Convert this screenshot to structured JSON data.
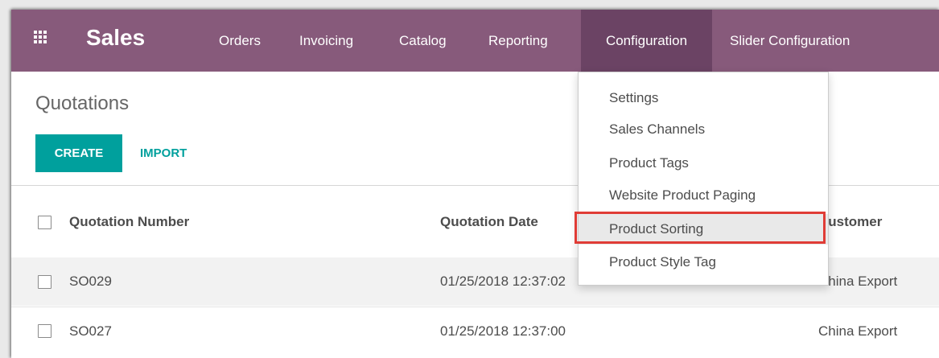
{
  "navbar": {
    "app_title": "Sales",
    "menu": [
      {
        "label": "Orders"
      },
      {
        "label": "Invoicing"
      },
      {
        "label": "Catalog"
      },
      {
        "label": "Reporting"
      },
      {
        "label": "Configuration",
        "active": true
      },
      {
        "label": "Slider Configuration"
      }
    ],
    "apps_icon": "grid-icon",
    "bg_color": "#875a7b",
    "active_bg_color": "#6b4364"
  },
  "page": {
    "title": "Quotations",
    "create_label": "CREATE",
    "import_label": "IMPORT",
    "accent_color": "#00a09d"
  },
  "table": {
    "columns": [
      "Quotation Number",
      "Quotation Date",
      "Customer"
    ],
    "rows": [
      {
        "number": "SO029",
        "date": "01/25/2018 12:37:02",
        "customer": "China Export"
      },
      {
        "number": "SO027",
        "date": "01/25/2018 12:37:00",
        "customer": "China Export"
      }
    ]
  },
  "dropdown": {
    "items": [
      {
        "label": "Settings"
      },
      {
        "label": "Sales Channels"
      },
      {
        "label": "Product Tags"
      },
      {
        "label": "Website Product Paging"
      },
      {
        "label": "Product Sorting",
        "highlighted": true
      },
      {
        "label": "Product Style Tag"
      }
    ],
    "highlight_color": "#e03c36"
  }
}
